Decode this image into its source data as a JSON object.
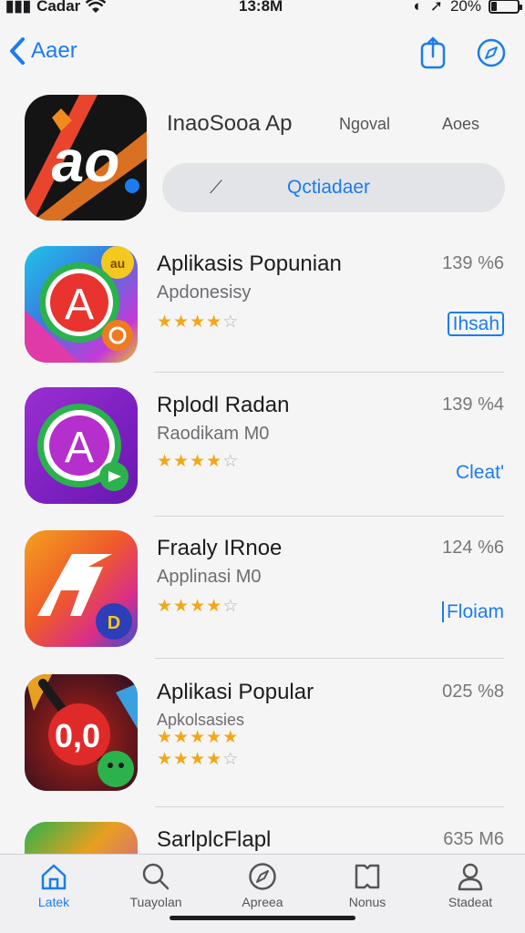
{
  "status": {
    "carrier": "Cadar",
    "time": "13:8M",
    "battery_percent": "20%",
    "battery_level": 0.2
  },
  "nav": {
    "back_label": "Aaer",
    "icons": [
      "share-icon",
      "compass-icon"
    ]
  },
  "featured": {
    "title": "InaoSooa Ap",
    "meta1": "Ngoval",
    "meta2": "Aoes",
    "search_text": "Qctiadaer",
    "icon_text": "ao"
  },
  "apps": [
    {
      "name": "Aplikasis Popunian",
      "subtitle": "Apdonesisy",
      "size": "139 %6",
      "rating": 4,
      "action": "Ihsah",
      "icon_letter": "A",
      "badge": "au"
    },
    {
      "name": "Rplodl Radan",
      "subtitle": "Raodikam M0",
      "size": "139 %4",
      "rating": 4,
      "action": "Cleat'",
      "icon_letter": "A"
    },
    {
      "name": "Fraaly IRnoe",
      "subtitle": "Applinasi M0",
      "size": "124 %6",
      "rating": 4,
      "action": "Floiam",
      "icon_letter": "A",
      "badge": "D"
    },
    {
      "name": "Aplikasi Popular",
      "subtitle": "Apkolsasies",
      "size": "025 %8",
      "rating": 4,
      "extra_rating": 5,
      "action": "",
      "icon_letter": "0,0"
    },
    {
      "name": "SarlplcFlapl",
      "subtitle": "",
      "size": "635 M6",
      "rating": 0,
      "action": ""
    }
  ],
  "tabs": [
    {
      "label": "Latek",
      "icon": "home-icon",
      "active": true
    },
    {
      "label": "Tuayolan",
      "icon": "search-icon",
      "active": false
    },
    {
      "label": "Apreea",
      "icon": "compass-icon",
      "active": false
    },
    {
      "label": "Nonus",
      "icon": "book-icon",
      "active": false
    },
    {
      "label": "Stadeat",
      "icon": "person-icon",
      "active": false
    }
  ],
  "colors": {
    "accent": "#1a7cf0",
    "star": "#f0a818",
    "background": "#f5f5f6"
  }
}
